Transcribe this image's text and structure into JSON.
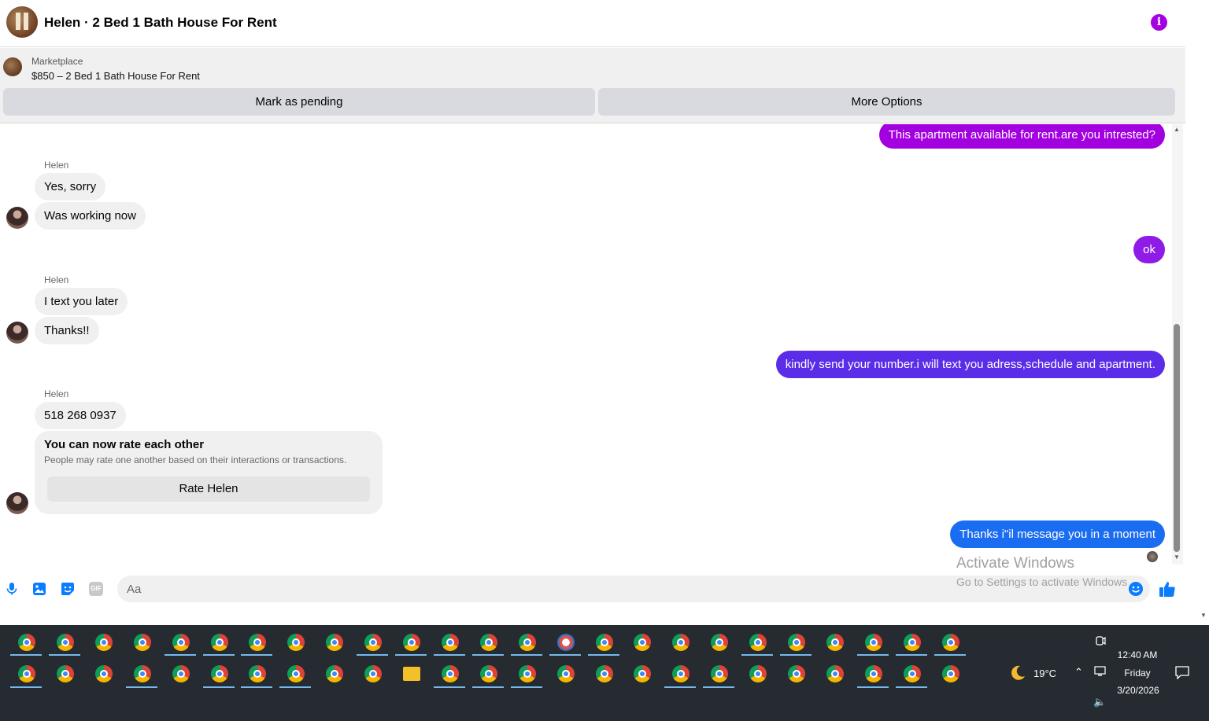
{
  "header": {
    "title": "Helen · 2 Bed 1 Bath House For Rent",
    "info_icon": "info-icon"
  },
  "listing": {
    "source": "Marketplace",
    "price_title": "$850 – 2 Bed 1 Bath House For Rent",
    "mark_pending_label": "Mark as pending",
    "more_options_label": "More Options"
  },
  "messages": {
    "out1": "This apartment available for rent.are you intrested?",
    "group1_sender": "Helen",
    "in1a": "Yes, sorry",
    "in1b": "Was working now",
    "out2": "ok",
    "group2_sender": "Helen",
    "in2a": "I text you later",
    "in2b": "Thanks!!",
    "out3": "kindly send your number.i will text you adress,schedule and apartment.",
    "group3_sender": "Helen",
    "in3a": "518 268 0937",
    "card_title": "You can now rate each other",
    "card_sub": "People may rate one another based on their interactions or transactions.",
    "card_button": "Rate Helen",
    "out4": "Thanks i\"il message you in a moment"
  },
  "colors": {
    "out1": "#a300e0",
    "out2": "#8f1be6",
    "out3": "#5b2de8",
    "out4": "#1a6df0",
    "accent": "#0a7cff"
  },
  "composer": {
    "placeholder": "Aa",
    "icons": [
      "microphone-icon",
      "photo-icon",
      "sticker-icon",
      "gif-icon",
      "emoji-icon",
      "like-icon"
    ],
    "gif_label": "GIF"
  },
  "watermark": {
    "line1": "Activate Windows",
    "line2": "Go to Settings to activate Windows"
  },
  "taskbar": {
    "weather": "19°C",
    "time": "12:40 AM",
    "day": "Friday",
    "date": "3/20/2026"
  }
}
